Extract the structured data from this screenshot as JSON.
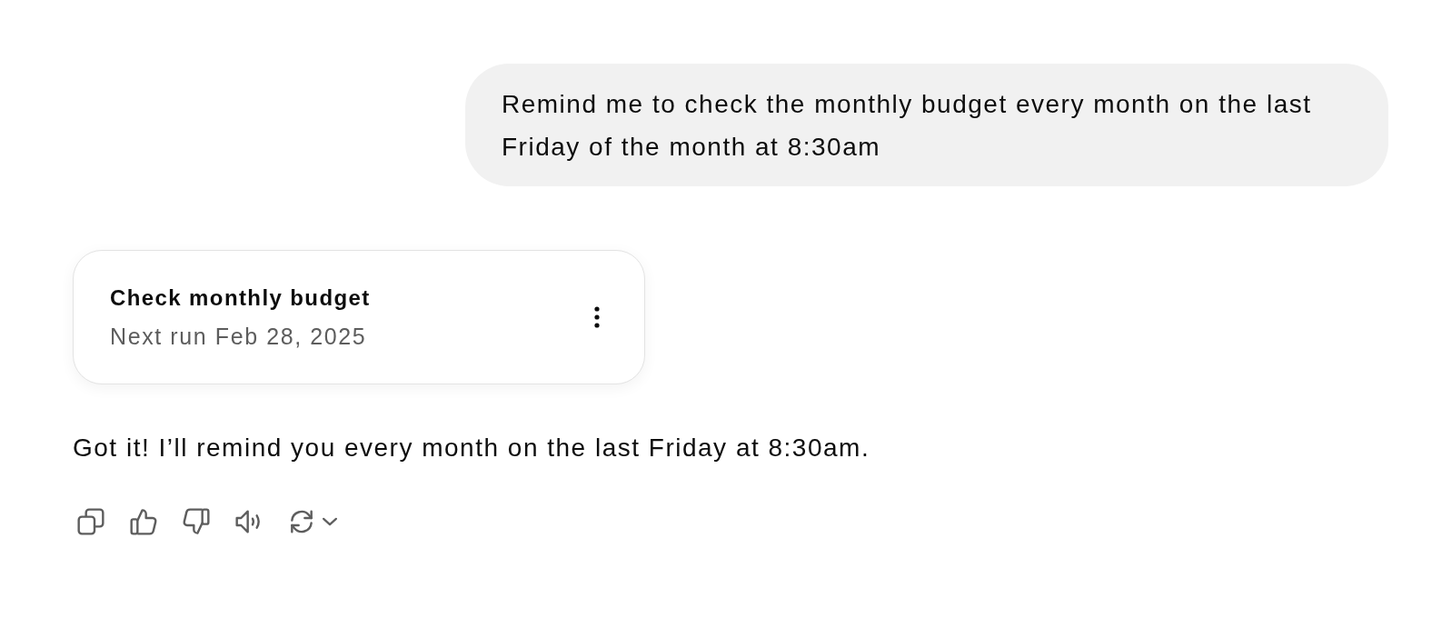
{
  "user_message": {
    "text": "Remind me to check the monthly budget every month on the last Friday of the month at 8:30am"
  },
  "task_card": {
    "title": "Check monthly budget",
    "subtitle": "Next run Feb 28, 2025"
  },
  "assistant_message": {
    "text": "Got it! I’ll remind you every month on the last Friday at 8:30am."
  },
  "actions": [
    {
      "kind": "copy"
    },
    {
      "kind": "thumbs_up"
    },
    {
      "kind": "thumbs_down"
    },
    {
      "kind": "read_aloud"
    },
    {
      "kind": "regenerate"
    }
  ]
}
